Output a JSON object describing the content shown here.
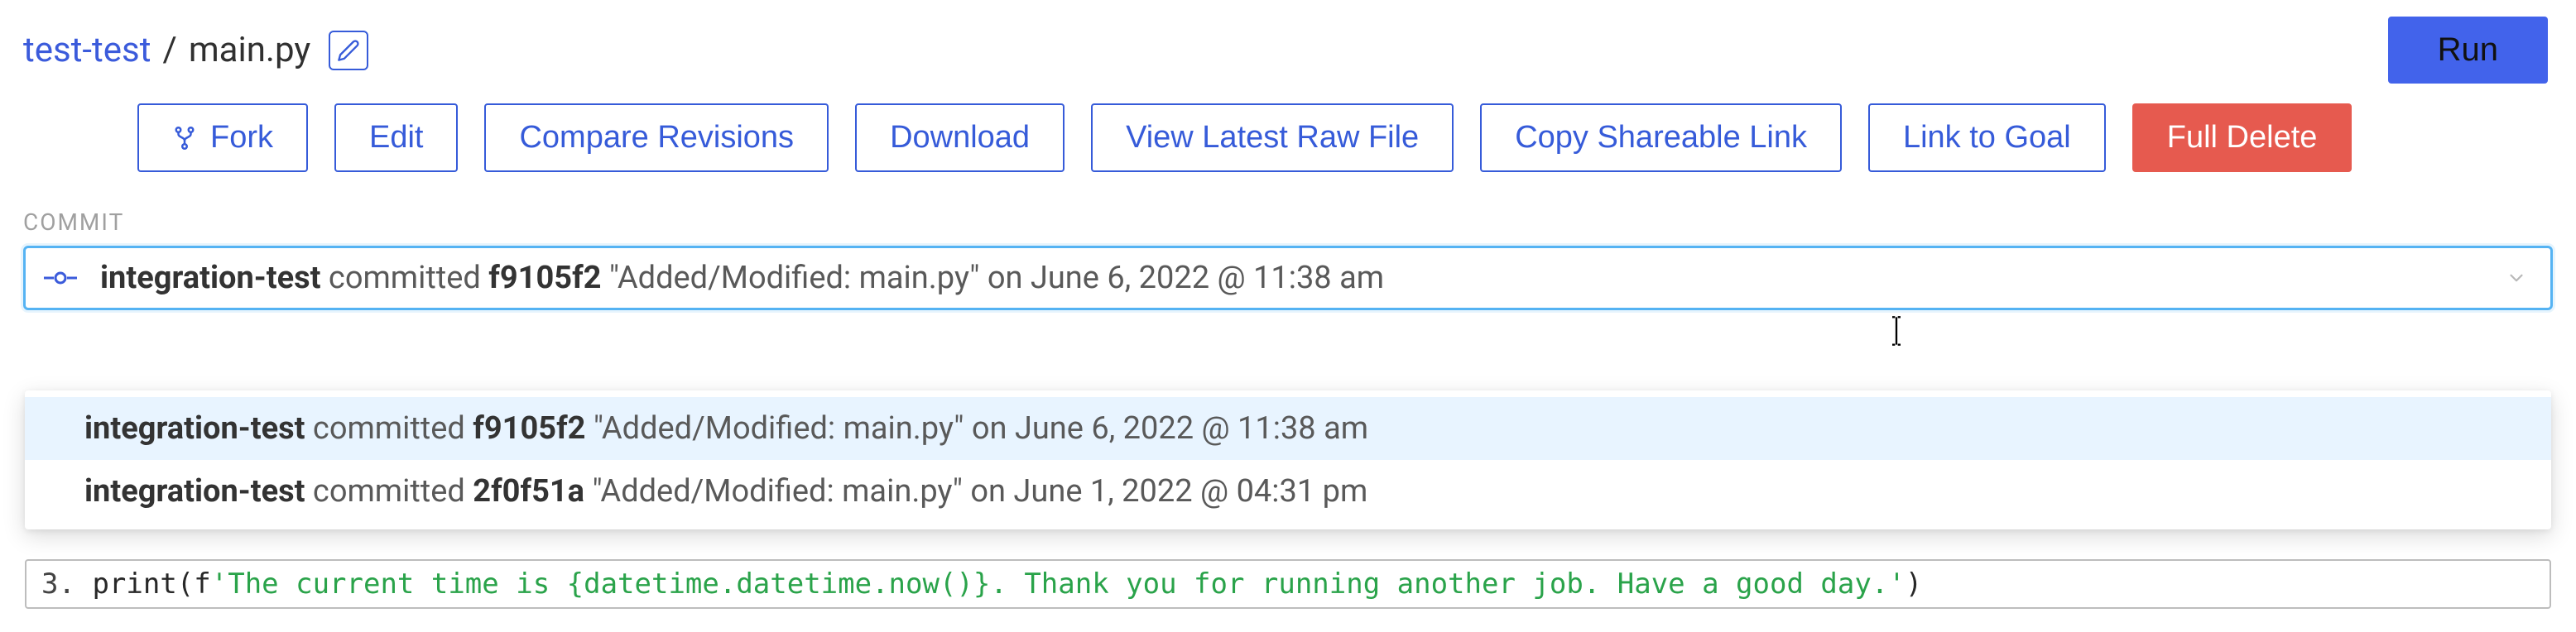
{
  "breadcrumb": {
    "repo": "test-test",
    "file": "main.py"
  },
  "run_label": "Run",
  "toolbar": {
    "fork": "Fork",
    "edit": "Edit",
    "compare": "Compare Revisions",
    "download": "Download",
    "view_raw": "View Latest Raw File",
    "copy_link": "Copy Shareable Link",
    "link_goal": "Link to Goal",
    "full_delete": "Full Delete"
  },
  "commit_section_label": "COMMIT",
  "selected_commit": {
    "author": "integration-test",
    "verb": "committed",
    "hash": "f9105f2",
    "message": "\"Added/Modified: main.py\"",
    "when": "on June 6, 2022 @ 11:38 am"
  },
  "commits": [
    {
      "author": "integration-test",
      "verb": "committed",
      "hash": "f9105f2",
      "message": "\"Added/Modified: main.py\"",
      "when": "on June 6, 2022 @ 11:38 am"
    },
    {
      "author": "integration-test",
      "verb": "committed",
      "hash": "2f0f51a",
      "message": "\"Added/Modified: main.py\"",
      "when": "on June 1, 2022 @ 04:31 pm"
    }
  ],
  "code": {
    "line_no": "3.",
    "func": "print",
    "paren_open": "(",
    "prefix": "f",
    "string": "'The current time is {datetime.datetime.now()}. Thank you for running another job. Have a good day.'",
    "paren_close": ")"
  }
}
